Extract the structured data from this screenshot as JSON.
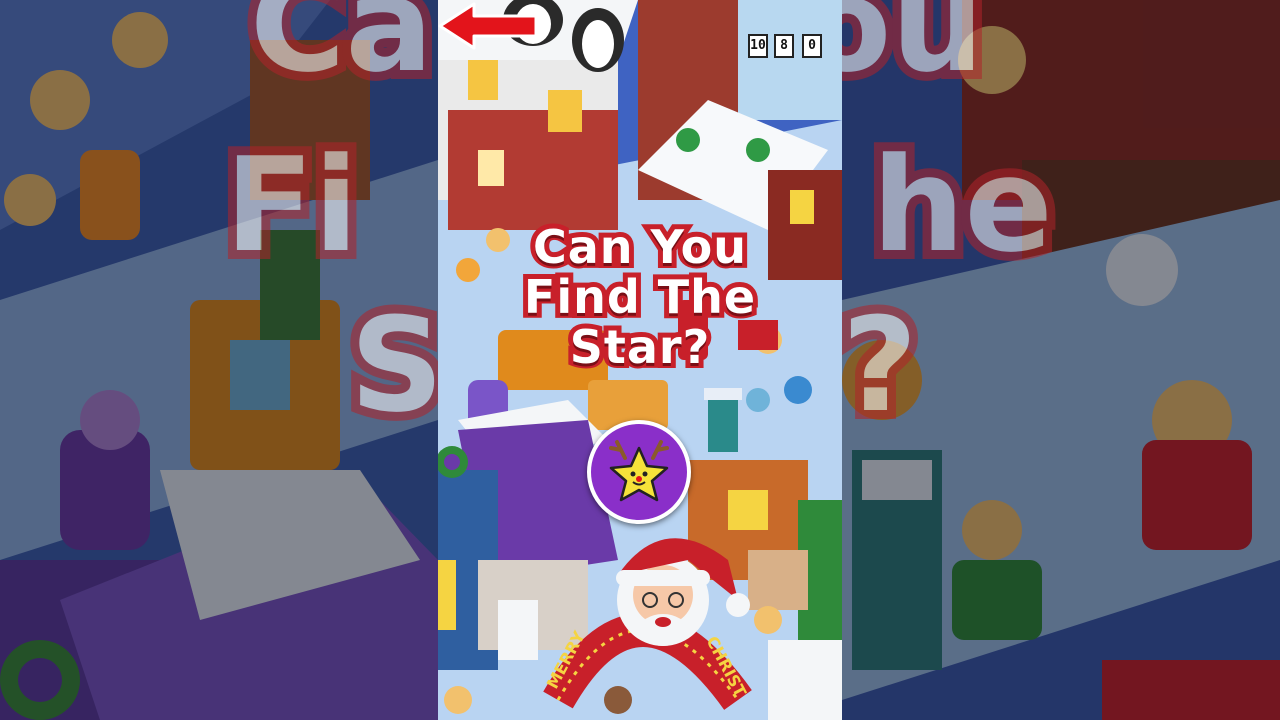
{
  "headline": {
    "line1": "Can You",
    "line2": "Find The",
    "line3": "Star?"
  },
  "background_echo": {
    "left_fragments": [
      "Ca",
      "Fi",
      "S"
    ],
    "right_fragments": [
      "ou",
      "he",
      "?"
    ]
  },
  "scene": {
    "score_cards": [
      "10",
      "8",
      "0"
    ],
    "arch_text_left": "MERRY",
    "arch_text_right": "CHRIST"
  },
  "answer_marker": {
    "icon": "reindeer-star-icon",
    "badge_color": "#8a2fc9",
    "arrow_color": "#e3141b"
  },
  "colors": {
    "title_fill": "#ffffff",
    "title_stroke": "#c8202a"
  }
}
